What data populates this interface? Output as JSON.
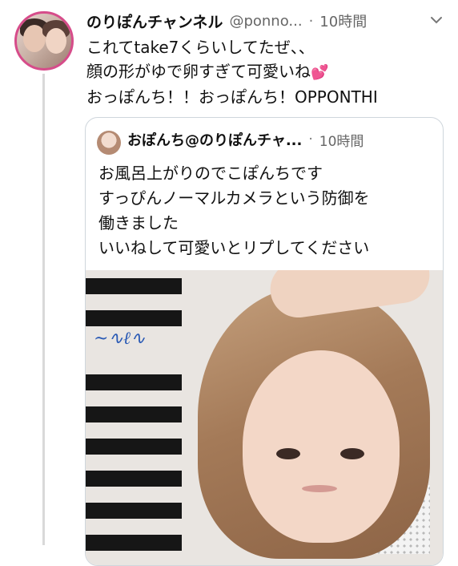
{
  "tweet": {
    "author_name": "のりぽんチャンネル",
    "handle": "@ponno...",
    "separator": "·",
    "time": "10時間",
    "body_lines": [
      "これてtake7くらいしてたぜ、、",
      "顔の形がゆで卵すぎて可愛いね",
      "おっぽんち！！おっぽんち！OPPONTHI"
    ],
    "heart_emoji": "💕",
    "menu_icon": "chevron-down-icon"
  },
  "quoted_tweet": {
    "author": "おぽんち@のりぽんチャ...",
    "separator": "·",
    "time": "10時間",
    "body_lines": [
      "お風呂上がりのでこぽんちです",
      "すっぴんノーマルカメラという防御を",
      "働きました",
      "いいねして可愛いとリプしてください"
    ]
  },
  "colors": {
    "avatar_ring": "#d64c8a",
    "heart": "#e8306b",
    "border": "#cfd6dc",
    "muted_text": "#666666"
  }
}
